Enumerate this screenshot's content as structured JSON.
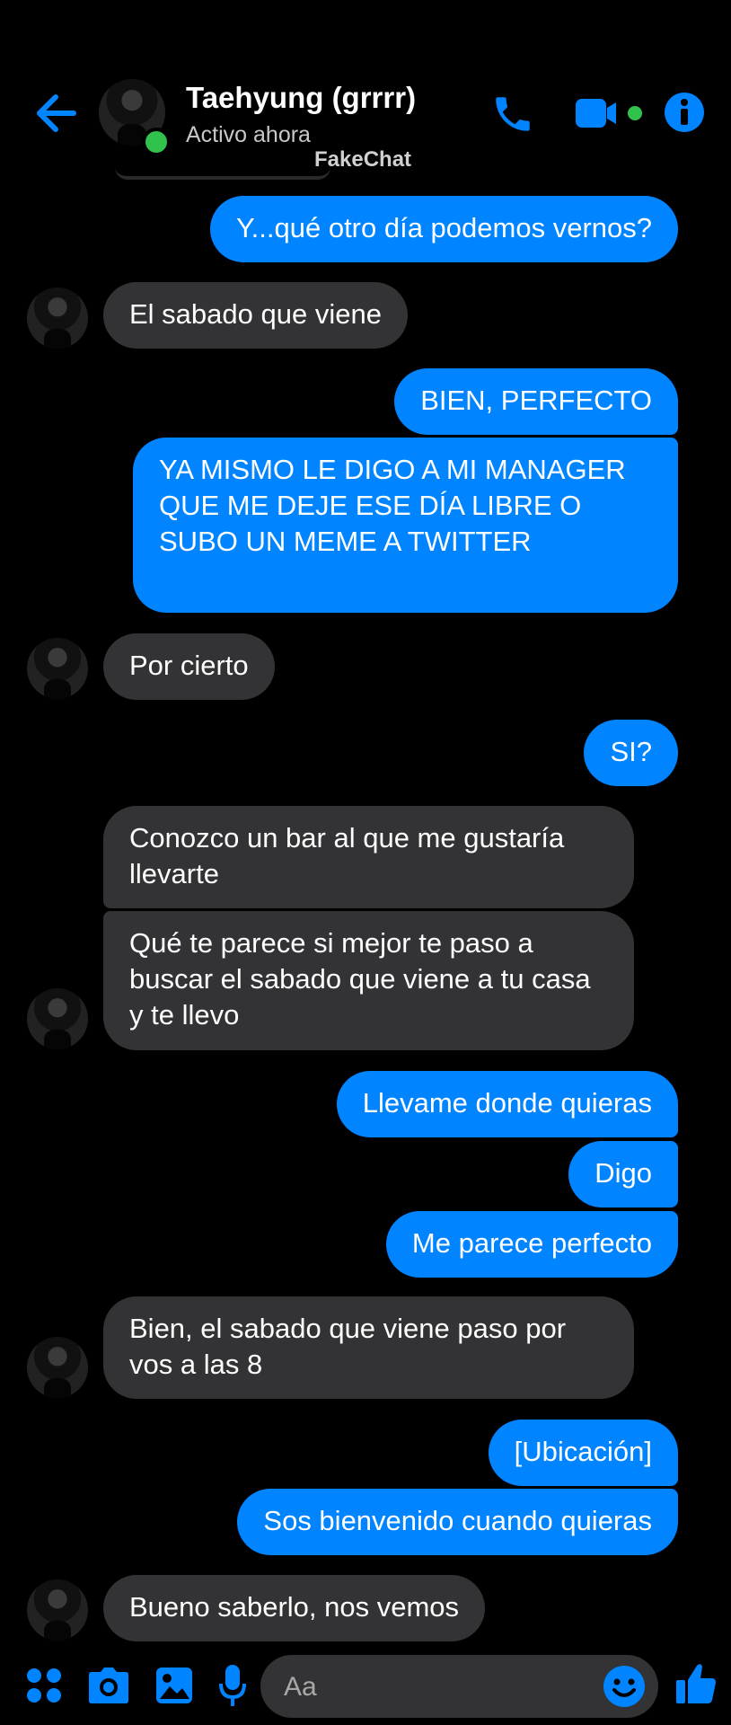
{
  "header": {
    "contact_name": "Taehyung (grrrr)",
    "status": "Activo ahora",
    "watermark": "FakeChat",
    "icons": [
      "back-arrow-icon",
      "phone-icon",
      "video-camera-icon",
      "info-icon"
    ]
  },
  "colors": {
    "sent_bubble": "#0084ff",
    "received_bubble": "#333336",
    "accent": "#0084ff",
    "online": "#31c24d",
    "background": "#000000"
  },
  "messages": [
    {
      "from": "me",
      "text": "Y...qué otro día podemos vernos?"
    },
    {
      "from": "them",
      "text": "El sabado que viene"
    },
    {
      "from": "me",
      "text": "BIEN, PERFECTO"
    },
    {
      "from": "me",
      "text": "YA MISMO LE DIGO A MI MANAGER QUE ME DEJE ESE DÍA LIBRE O SUBO UN MEME A TWITTER"
    },
    {
      "from": "them",
      "text": "Por cierto"
    },
    {
      "from": "me",
      "text": "SI?"
    },
    {
      "from": "them",
      "text": "Conozco un bar al que me gustaría llevarte"
    },
    {
      "from": "them",
      "text": "Qué te parece si mejor te paso a buscar el sabado que viene a tu casa y te llevo"
    },
    {
      "from": "me",
      "text": "Llevame donde quieras"
    },
    {
      "from": "me",
      "text": "Digo"
    },
    {
      "from": "me",
      "text": "Me parece perfecto"
    },
    {
      "from": "them",
      "text": "Bien, el sabado que viene paso por vos a las 8"
    },
    {
      "from": "me",
      "text": "[Ubicación]"
    },
    {
      "from": "me",
      "text": "Sos bienvenido cuando quieras"
    },
    {
      "from": "them",
      "text": "Bueno saberlo, nos vemos"
    }
  ],
  "composer": {
    "placeholder": "Aa",
    "icons": [
      "apps-icon",
      "camera-icon",
      "gallery-icon",
      "microphone-icon",
      "emoji-icon",
      "thumbs-up-icon"
    ]
  }
}
